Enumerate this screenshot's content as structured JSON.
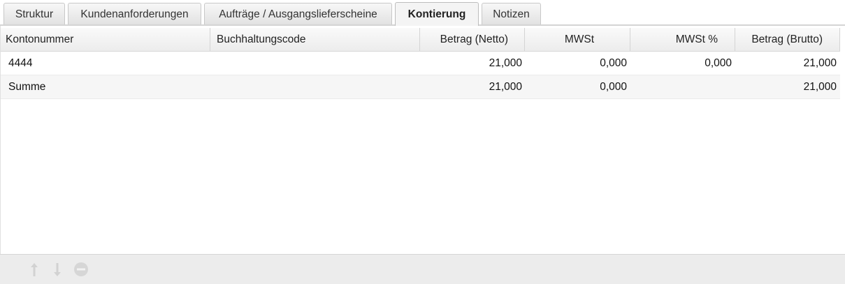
{
  "tabs": [
    {
      "label": "Struktur",
      "active": false
    },
    {
      "label": "Kundenanforderungen",
      "active": false
    },
    {
      "label": "Aufträge / Ausgangslieferscheine",
      "active": false
    },
    {
      "label": "Kontierung",
      "active": true
    },
    {
      "label": "Notizen",
      "active": false
    }
  ],
  "table": {
    "columns": [
      "Kontonummer",
      "Buchhaltungscode",
      "Betrag (Netto)",
      "MWSt",
      "MWSt %",
      "Betrag (Brutto)"
    ],
    "rows": [
      [
        "4444",
        "",
        "21,000",
        "0,000",
        "0,000",
        "21,000"
      ],
      [
        "Summe",
        "",
        "21,000",
        "0,000",
        "",
        "21,000"
      ]
    ]
  },
  "footer": {
    "icons": [
      "arrow-up-icon",
      "arrow-down-icon",
      "remove-icon"
    ]
  },
  "colors": {
    "active_tab_bg": "#f4f4f4",
    "header_bg": "#ececec",
    "footer_bg": "#ececec",
    "disabled_icon": "#cfcfcf"
  }
}
